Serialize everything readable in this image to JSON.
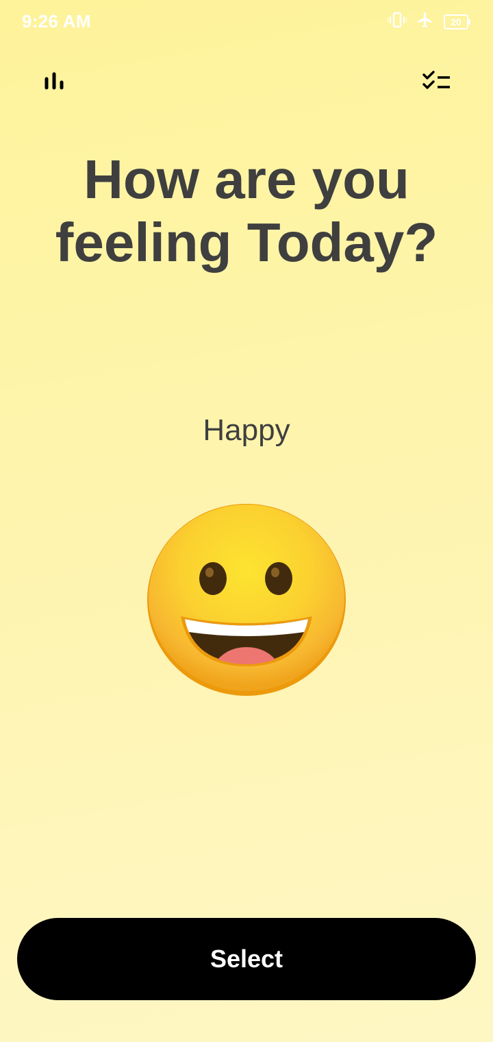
{
  "status_bar": {
    "time": "9:26 AM",
    "battery_level": "20",
    "icons": [
      "vibrate-icon",
      "airplane-mode-icon",
      "battery-icon"
    ]
  },
  "toolbar": {
    "left_icon": "bar-chart-icon",
    "right_icon": "checklist-icon"
  },
  "headline": "How are you feeling Today?",
  "mood": {
    "label": "Happy",
    "emoji": "grinning-face-icon"
  },
  "select_button_label": "Select",
  "colors": {
    "background_top": "#fef39a",
    "background_bottom": "#fef7c4",
    "text": "#3f3f3f",
    "button_bg": "#000000",
    "button_text": "#ffffff",
    "emoji_face": "#fbd02f"
  }
}
